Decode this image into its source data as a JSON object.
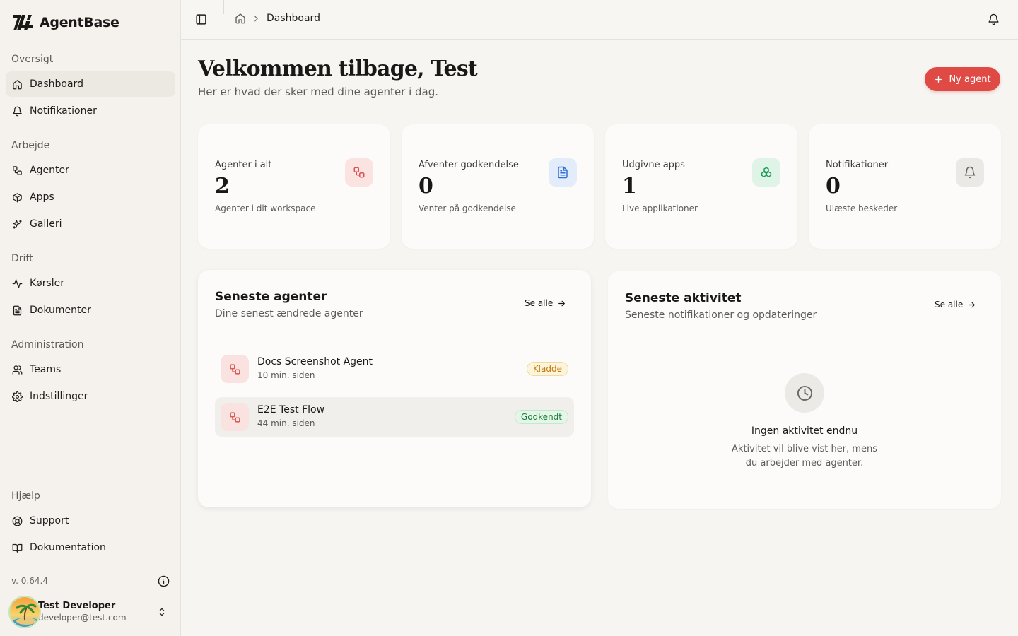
{
  "app": {
    "name": "AgentBase"
  },
  "sidebar": {
    "groups": [
      {
        "heading": "Oversigt",
        "items": [
          {
            "label": "Dashboard",
            "icon": "home-icon",
            "active": true
          },
          {
            "label": "Notifikationer",
            "icon": "bell-icon"
          }
        ]
      },
      {
        "heading": "Arbejde",
        "items": [
          {
            "label": "Agenter",
            "icon": "workflow-icon"
          },
          {
            "label": "Apps",
            "icon": "box-icon"
          },
          {
            "label": "Galleri",
            "icon": "sparkles-icon"
          }
        ]
      },
      {
        "heading": "Drift",
        "items": [
          {
            "label": "Kørsler",
            "icon": "activity-icon"
          },
          {
            "label": "Dokumenter",
            "icon": "file-text-icon"
          }
        ]
      },
      {
        "heading": "Administration",
        "items": [
          {
            "label": "Teams",
            "icon": "users-icon"
          },
          {
            "label": "Indstillinger",
            "icon": "gear-icon"
          }
        ]
      },
      {
        "heading": "Hjælp",
        "items": [
          {
            "label": "Support",
            "icon": "life-buoy-icon"
          },
          {
            "label": "Dokumentation",
            "icon": "book-open-icon"
          }
        ]
      }
    ],
    "version": "v. 0.64.4",
    "user": {
      "name": "Test Developer",
      "email": "developer@test.com"
    }
  },
  "topbar": {
    "breadcrumb": "Dashboard"
  },
  "main": {
    "title": "Velkommen tilbage, Test",
    "subtitle": "Her er hvad der sker med dine agenter i dag.",
    "new_agent_label": "Ny agent",
    "stats": [
      {
        "label": "Agenter i alt",
        "value": "2",
        "sub": "Agenter i dit workspace",
        "icon": "workflow-icon",
        "color": "#d9534f",
        "bg": "#fbe3e1"
      },
      {
        "label": "Afventer godkendelse",
        "value": "0",
        "sub": "Venter på godkendelse",
        "icon": "file-text-icon",
        "color": "#2f6fd6",
        "bg": "#e2ecfb"
      },
      {
        "label": "Udgivne apps",
        "value": "1",
        "sub": "Live applikationer",
        "icon": "boxes-icon",
        "color": "#1f9d5a",
        "bg": "#dff3e7"
      },
      {
        "label": "Notifikationer",
        "value": "0",
        "sub": "Ulæste beskeder",
        "icon": "bell-icon",
        "color": "#6b6762",
        "bg": "#ebe9e6"
      }
    ],
    "recent_agents": {
      "title": "Seneste agenter",
      "subtitle": "Dine senest ændrede agenter",
      "see_all": "Se alle",
      "items": [
        {
          "name": "Docs Screenshot Agent",
          "time": "10 min. siden",
          "status": "Kladde"
        },
        {
          "name": "E2E Test Flow",
          "time": "44 min. siden",
          "status": "Godkendt"
        }
      ]
    },
    "recent_activity": {
      "title": "Seneste aktivitet",
      "subtitle": "Seneste notifikationer og opdateringer",
      "see_all": "Se alle",
      "empty_title": "Ingen aktivitet endnu",
      "empty_text": "Aktivitet vil blive vist her, mens du arbejder med agenter."
    }
  }
}
